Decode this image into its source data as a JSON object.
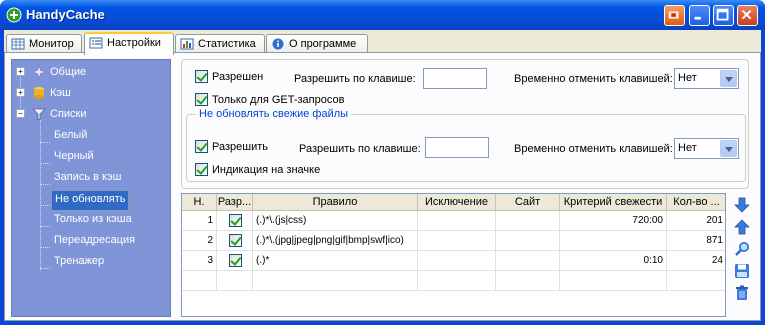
{
  "window": {
    "title": "HandyCache"
  },
  "tabs": [
    {
      "label": "Монитор"
    },
    {
      "label": "Настройки"
    },
    {
      "label": "Статистика"
    },
    {
      "label": "О программе"
    }
  ],
  "tree": {
    "items": [
      {
        "label": "Общие"
      },
      {
        "label": "Кэш"
      },
      {
        "label": "Списки"
      },
      {
        "label": "Белый"
      },
      {
        "label": "Черный"
      },
      {
        "label": "Запись в кэш"
      },
      {
        "label": "Не обновлять"
      },
      {
        "label": "Только из кэша"
      },
      {
        "label": "Переадресация"
      },
      {
        "label": "Тренажер"
      }
    ],
    "selected": "Не обновлять"
  },
  "settings": {
    "enabled_label": "Разрешен",
    "hotkey_label": "Разрешить по клавише:",
    "hotkey_value": "",
    "temp_cancel_label": "Временно отменить клавишей:",
    "temp_cancel_value": "Нет",
    "get_only_label": "Только для GET-запросов"
  },
  "fresh_group": {
    "legend": "Не обновлять свежие файлы",
    "enable_label": "Разрешить",
    "hotkey_label": "Разрешить по клавише:",
    "hotkey_value": "",
    "temp_cancel_label": "Временно отменить клавишей:",
    "temp_cancel_value": "Нет",
    "indicator_label": "Индикация на значке"
  },
  "table": {
    "columns": [
      "Н.",
      "Разр...",
      "Правило",
      "Исключение",
      "Сайт",
      "Критерий свежести",
      "Кол-во ..."
    ],
    "rows": [
      {
        "n": "1",
        "enabled": true,
        "rule": "(.)*\\.(js|css)",
        "exception": "",
        "site": "",
        "freshness": "720:00",
        "count": "201"
      },
      {
        "n": "2",
        "enabled": true,
        "rule": "(.)*\\.(jpg|jpeg|png|gif|bmp|swf|ico)",
        "exception": "",
        "site": "",
        "freshness": "",
        "count": "871"
      },
      {
        "n": "3",
        "enabled": true,
        "rule": "(.)*",
        "exception": "",
        "site": "",
        "freshness": "0:10",
        "count": "24"
      }
    ]
  },
  "side_icons": [
    "arrow-down-icon",
    "arrow-up-icon",
    "search-icon",
    "save-icon",
    "trash-icon"
  ],
  "colors": {
    "titlebar": "#0055e5",
    "tree_bg": "#7f95d8",
    "selection": "#316ac5",
    "legend": "#0046d5"
  }
}
